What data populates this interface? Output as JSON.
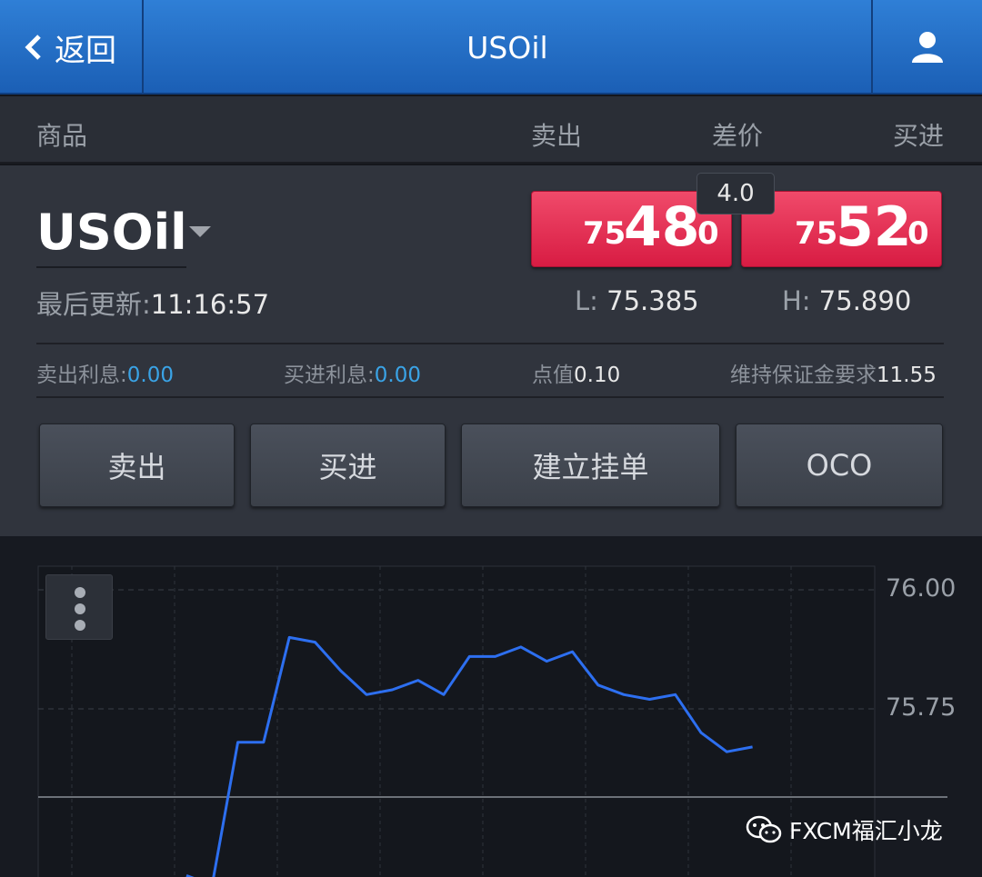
{
  "nav": {
    "back_label": "返回",
    "title": "USOil"
  },
  "header": {
    "product": "商品",
    "sell": "卖出",
    "spread": "差价",
    "buy": "买进"
  },
  "instrument": {
    "symbol": "USOil",
    "last_update_label": "最后更新:",
    "last_update_time": "11:16:57",
    "sell_price": {
      "prefix": "75",
      "big": "48",
      "tail": "0"
    },
    "buy_price": {
      "prefix": "75",
      "big": "52",
      "tail": "0"
    },
    "spread": "4.0",
    "low_label": "L:",
    "low": "75.385",
    "high_label": "H:",
    "high": "75.890"
  },
  "info": {
    "sell_interest_label": "卖出利息:",
    "sell_interest": "0.00",
    "buy_interest_label": "买进利息:",
    "buy_interest": "0.00",
    "pip_label": "点值",
    "pip": "0.10",
    "margin_label": "维持保证金要求",
    "margin": "11.55"
  },
  "actions": {
    "sell": "卖出",
    "buy": "买进",
    "pending": "建立挂单",
    "oco": "OCO"
  },
  "chart_data": {
    "type": "line",
    "y_ticks": [
      "76.00",
      "75.75"
    ],
    "ylim": [
      75.37,
      76.05
    ],
    "values": [
      75.4,
      75.38,
      75.68,
      75.68,
      75.9,
      75.89,
      75.83,
      75.78,
      75.79,
      75.81,
      75.78,
      75.86,
      75.86,
      75.88,
      75.85,
      75.87,
      75.8,
      75.78,
      75.77,
      75.78,
      75.7,
      75.66,
      75.67
    ],
    "reference_line": 75.565
  },
  "watermark": "FXCM福汇小龙",
  "icons": {
    "back": "chevron-left-icon",
    "user": "user-icon",
    "menu": "more-vertical-icon",
    "dropdown": "caret-down-icon",
    "wechat": "wechat-icon"
  }
}
